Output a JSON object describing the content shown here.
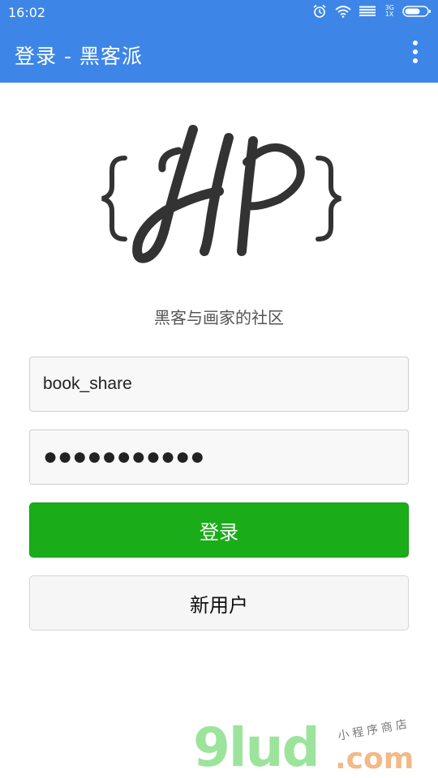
{
  "status_bar": {
    "time": "16:02",
    "network_label_top": "3G",
    "network_label_bottom": "1X"
  },
  "app_bar": {
    "title": "登录 - 黑客派",
    "menu_icon": "more-vert-icon"
  },
  "logo": {
    "brand_letters": "{HP}"
  },
  "tagline": "黑客与画家的社区",
  "form": {
    "username_value": "book_share",
    "password_value": "●●●●●●●●●●●",
    "login_label": "登录",
    "new_user_label": "新用户"
  },
  "watermark": {
    "main": "9lud",
    "domain": ".com",
    "sub": "小程序商店"
  },
  "colors": {
    "primary": "#3d86e8",
    "login_button": "#1aad19"
  }
}
